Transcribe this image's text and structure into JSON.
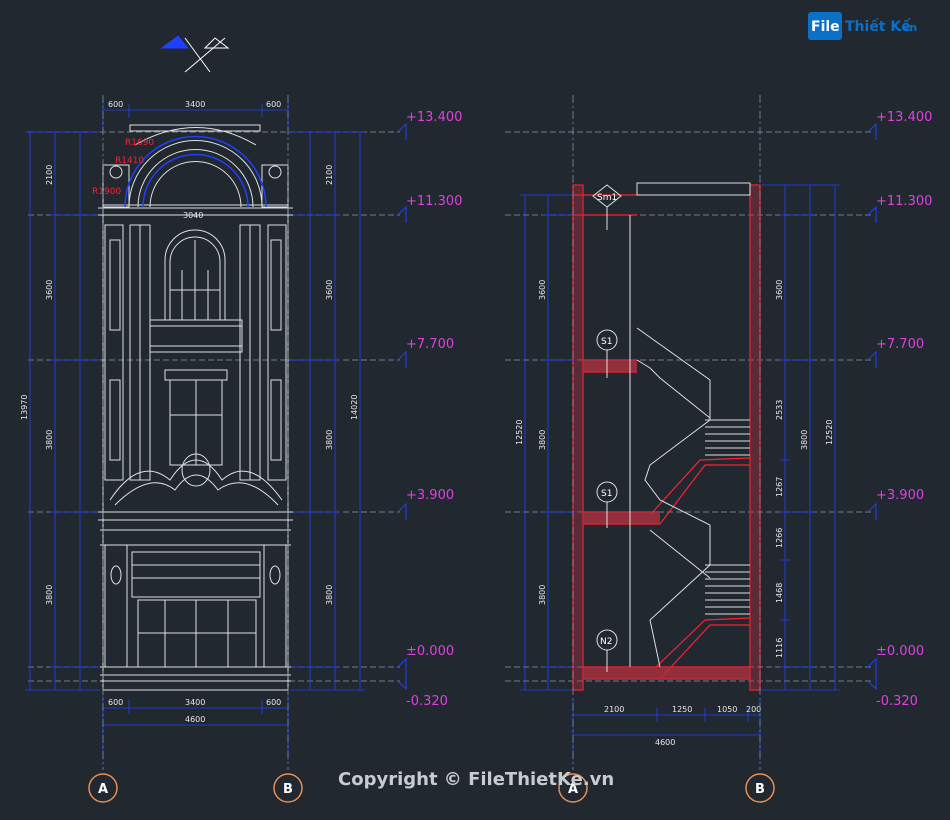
{
  "logo": {
    "part1": "File",
    "part2": "Thiết Kế",
    "suffix": ".vn"
  },
  "copyright": "Copyright © FileThietKe.vn",
  "elevation": {
    "levels": [
      "+13.400",
      "+11.300",
      "+7.700",
      "+3.900",
      "±0.000",
      "-0.320"
    ],
    "top_dims": [
      "600",
      "3400",
      "600"
    ],
    "bottom_dims": [
      "600",
      "3400",
      "600"
    ],
    "overall_width": "4600",
    "left_overall": "13970",
    "right_overall": "14020",
    "left_dims": [
      "2100",
      "3600",
      "3800",
      "3800"
    ],
    "right_dims": [
      "2100",
      "3600",
      "3800",
      "3800"
    ],
    "arch_labels": [
      "R1410",
      "R1690",
      "R1900",
      "3040"
    ],
    "grid": [
      "A",
      "B"
    ]
  },
  "section": {
    "levels": [
      "+13.400",
      "+11.300",
      "+7.700",
      "+3.900",
      "±0.000",
      "-0.320"
    ],
    "markers": [
      "Sm1",
      "S1",
      "S1",
      "N2"
    ],
    "bottom_dims": [
      "2100",
      "1250",
      "1050",
      "200"
    ],
    "overall_width": "4600",
    "left_overall": "12520",
    "right_overall": "12520",
    "left_dims": [
      "3600",
      "3800",
      "3800"
    ],
    "right_dims": [
      "3600",
      "2533",
      "1267",
      "1266",
      "1468",
      "1116",
      "3800"
    ],
    "grid": [
      "A",
      "B"
    ]
  },
  "colors": {
    "background": "#212830",
    "level_text": "#e040e0",
    "dimension": "#1a30ff",
    "section_cut": "#ff2030",
    "linework": "#e0e0e0"
  }
}
